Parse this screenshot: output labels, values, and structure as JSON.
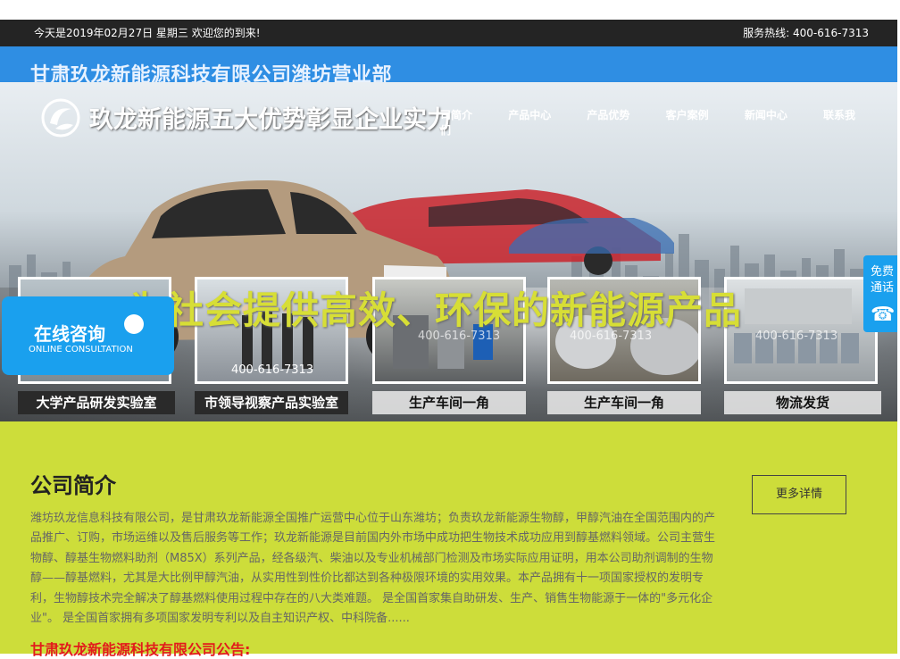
{
  "topbar": {
    "date_text": "今天是2019年02月27日 星期三 欢迎您的到来!",
    "hotline": "服务热线:   400-616-7313"
  },
  "brand": {
    "company": "甘肃玖龙新能源科技有限公司潍坊营业部"
  },
  "hero": {
    "logo_icon": "swirl-logo-icon",
    "slogan_top": "玖龙新能源五大优势彰显企业实力",
    "nav": [
      "司简介",
      "产品中心",
      "产品优势",
      "客户案例",
      "新闻中心",
      "联系我们"
    ],
    "slogan_main": "为社会提供高效、环保的新能源产品",
    "photos": [
      {
        "caption": "大学产品研发实验室",
        "watermark": ""
      },
      {
        "caption": "市领导视察产品实验室",
        "watermark": "400-616-7313"
      },
      {
        "caption": "生产车间一角",
        "watermark": "400-616-7313"
      },
      {
        "caption": "生产车间一角",
        "watermark": "400-616-7313"
      },
      {
        "caption": "物流发货",
        "watermark": "400-616-7313"
      }
    ]
  },
  "consult": {
    "label_cn": "在线咨询",
    "label_en": "ONLINE CONSULTATION",
    "icon": "chat-bubble-icon"
  },
  "side_tab": {
    "label": "免费通话",
    "icon": "phone-icon"
  },
  "about": {
    "title": "公司简介",
    "more_label": "更多详情",
    "body": "潍坊玖龙信息科技有限公司，是甘肃玖龙新能源全国推广运营中心位于山东潍坊；负责玖龙新能源生物醇，甲醇汽油在全国范围内的产品推广、订购，市场运维以及售后服务等工作；玖龙新能源是目前国内外市场中成功把生物技术成功应用到醇基燃料领域。公司主营生物醇、醇基生物燃料助剂（M85X）系列产品，经各级汽、柴油以及专业机械部门检测及市场实际应用证明，用本公司助剂调制的生物醇——醇基燃料，尤其是大比例甲醇汽油，从实用性到性价比都达到各种极限环境的实用效果。本产品拥有十一项国家授权的发明专利，生物醇技术完全解决了醇基燃料使用过程中存在的八大类难题。 是全国首家集自助研发、生产、销售生物能源于一体的\"多元化企业\"。 是全国首家拥有多项国家发明专利以及自主知识产权、中科院备......",
    "notice": "甘肃玖龙新能源科技有限公司公告:"
  }
}
